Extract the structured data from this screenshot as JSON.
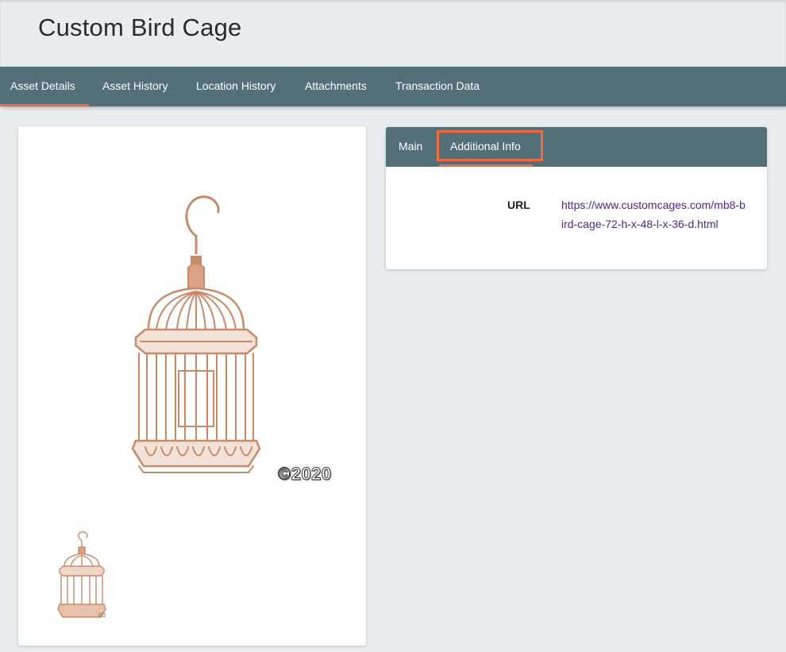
{
  "page": {
    "title": "Custom Bird Cage"
  },
  "nav": {
    "tabs": [
      {
        "label": "Asset Details",
        "active": true
      },
      {
        "label": "Asset History",
        "active": false
      },
      {
        "label": "Location History",
        "active": false
      },
      {
        "label": "Attachments",
        "active": false
      },
      {
        "label": "Transaction Data",
        "active": false
      }
    ]
  },
  "gallery": {
    "main_image": "bird-cage-image",
    "watermark": "©2020",
    "thumb_watermark": "©2",
    "thumbnails": [
      "bird-cage-thumbnail"
    ]
  },
  "details": {
    "tabs": [
      {
        "label": "Main",
        "active": false
      },
      {
        "label": "Additional Info",
        "active": true
      }
    ],
    "fields": [
      {
        "label": "URL",
        "value": "https://www.customcages.com/mb8-bird-cage-72-h-x-48-l-x-36-d.html"
      }
    ]
  },
  "colors": {
    "nav_background": "#537079",
    "active_indicator": "#ee6a44",
    "highlight": "#ef6a3f",
    "link": "#4a2b86",
    "page_background": "#e9edf0",
    "cage_copper": "#c98a6a"
  }
}
